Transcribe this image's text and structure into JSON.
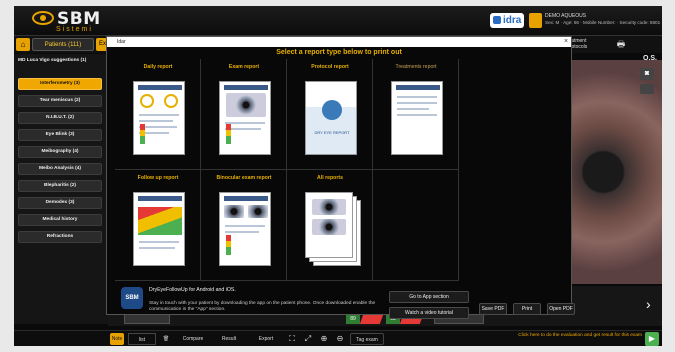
{
  "app": {
    "brand": "SBM",
    "brand_sub": "Sistemi",
    "partner": "idra"
  },
  "user": {
    "name": "DEMO AQUEOUS",
    "details": "Sex: M · Age: 56 · Mobile Number: · Security code: 8801"
  },
  "tabs": {
    "home": "⌂",
    "patients": "Patients (111)",
    "exams": "Exams",
    "treatments": "...atment protocols",
    "print": "🖶"
  },
  "sidebar": {
    "title": "MD Luca Vigo suggestions (1)",
    "items": [
      {
        "label": "Interferometry (3)",
        "active": true
      },
      {
        "label": "Tear meniscus (2)",
        "active": false
      },
      {
        "label": "N.I.B.U.T. (2)",
        "active": false
      },
      {
        "label": "Eye Blink (3)",
        "active": false
      },
      {
        "label": "Meibography (4)",
        "active": false
      },
      {
        "label": "Meibo Analysis (4)",
        "active": false
      },
      {
        "label": "Blepharitis (2)",
        "active": false
      },
      {
        "label": "Demodex (3)",
        "active": false
      },
      {
        "label": "Medical history",
        "active": false
      },
      {
        "label": "Refractions",
        "active": false
      }
    ]
  },
  "eye_panel": {
    "side": "O.S."
  },
  "modal": {
    "search_value": "Idar",
    "title": "Select a report type below to print out",
    "reports": [
      {
        "label": "Daily report",
        "dim": false
      },
      {
        "label": "Exam report",
        "dim": false
      },
      {
        "label": "Protocol report",
        "dim": false
      },
      {
        "label": "Treatments report",
        "dim": true
      },
      {
        "label": "Follow up report",
        "dim": false
      },
      {
        "label": "Binocular exam report",
        "dim": false
      },
      {
        "label": "All reports",
        "dim": false
      }
    ],
    "protocol_doc_caption": "DRY EYE REPORT",
    "footer": {
      "logo_text": "SBM",
      "app_title": "DryEyeFollowUp for Android and iOS.",
      "app_desc": "Stay in touch with your patient by downloading the app on the patient phone. Once downloaded enable the communication in the \"App\" section.",
      "btn_app": "Go to App section",
      "btn_video": "Watch a video tutorial",
      "btn_savepdf": "Save PDF",
      "btn_print": "Print",
      "btn_openpdf": "Open PDF"
    }
  },
  "timeline": {
    "scores": [
      "89",
      "93"
    ]
  },
  "bottom": {
    "btn_note": "Note",
    "btn_list": "list",
    "btn_compare": "Compare",
    "btn_result": "Result",
    "btn_export": "Export",
    "btn_tag": "Tag exam",
    "note": "Click here to do the evaluation and get result for this exam"
  },
  "colors": {
    "accent": "#e8a200",
    "green": "#4caf50",
    "red": "#e53935"
  }
}
